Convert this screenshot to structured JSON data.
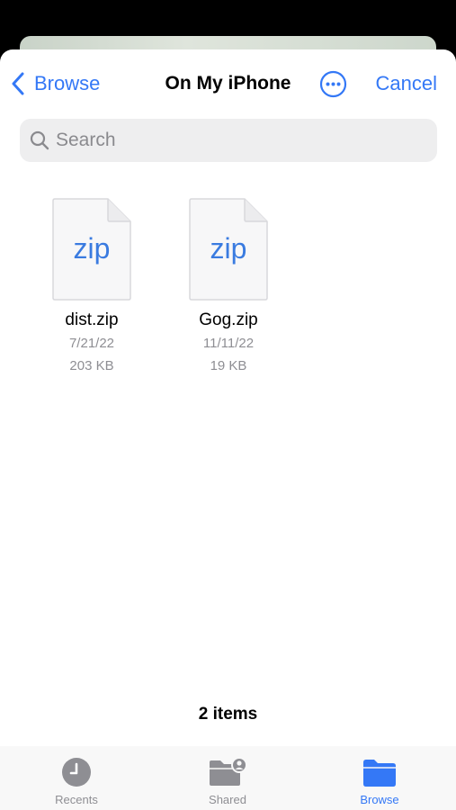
{
  "nav": {
    "back_label": "Browse",
    "title": "On My iPhone",
    "more_icon": "ellipsis-circle-icon",
    "cancel_label": "Cancel"
  },
  "search": {
    "placeholder": "Search",
    "value": ""
  },
  "files": [
    {
      "icon_text": "zip",
      "name": "dist.zip",
      "date": "7/21/22",
      "size": "203 KB"
    },
    {
      "icon_text": "zip",
      "name": "Gog.zip",
      "date": "11/11/22",
      "size": "19 KB"
    }
  ],
  "footer": {
    "items_count": "2 items"
  },
  "tabbar": {
    "tabs": [
      {
        "label": "Recents",
        "icon": "clock-icon",
        "active": false
      },
      {
        "label": "Shared",
        "icon": "shared-folder-icon",
        "active": false
      },
      {
        "label": "Browse",
        "icon": "folder-icon",
        "active": true
      }
    ]
  },
  "colors": {
    "accent": "#3478f6",
    "secondary_text": "#8e8e93",
    "search_bg": "#eeeeef",
    "tab_inactive": "#8e8e93"
  }
}
